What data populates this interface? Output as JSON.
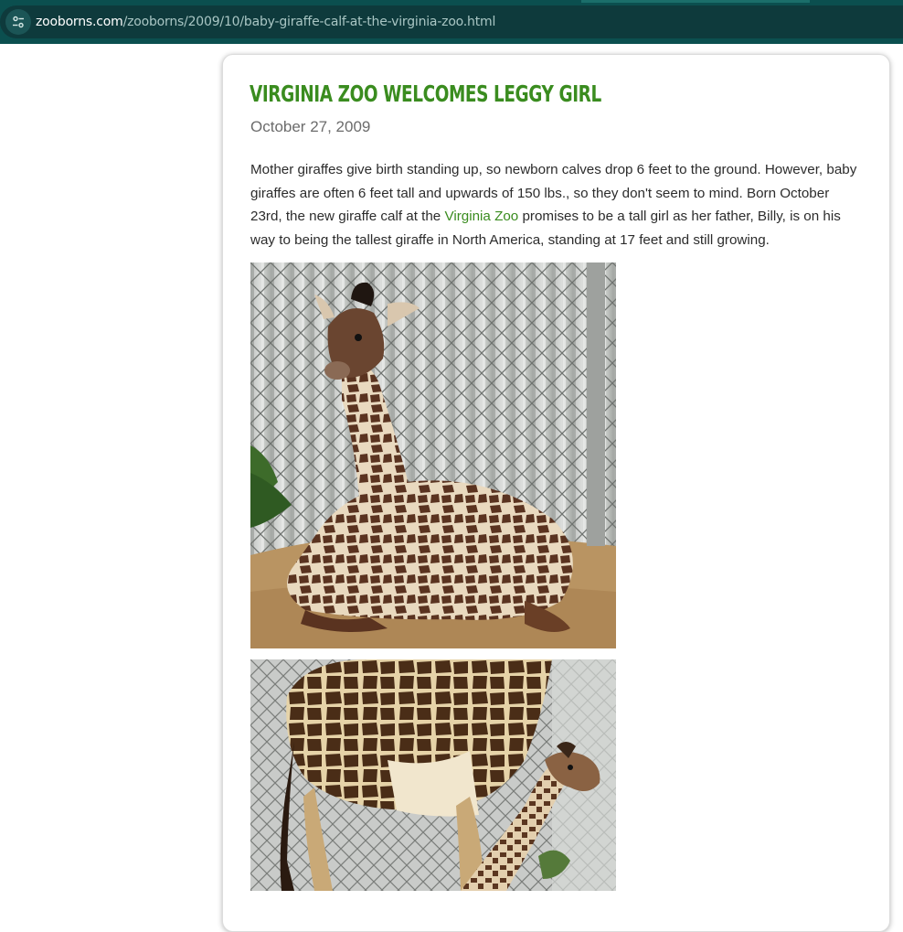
{
  "browser": {
    "url_domain": "zooborns.com",
    "url_path": "/zooborns/2009/10/baby-giraffe-calf-at-the-virginia-zoo.html",
    "site_info_icon": "tune-icon"
  },
  "post": {
    "title": "Virginia Zoo Welcomes Leggy Girl",
    "date": "October 27, 2009",
    "body_before_link": "Mother giraffes give birth standing up, so newborn calves drop 6 feet to the ground. However, baby giraffes are often 6 feet tall and upwards of 150 lbs., so they don't seem to mind. Born October 23rd, the new giraffe calf at the ",
    "link_text": "Virginia Zoo",
    "body_after_link": " promises to be a tall girl as her father, Billy, is on his way to being the tallest giraffe in North America, standing at 17 feet and still growing."
  },
  "colors": {
    "title_green": "#3a8c1f",
    "link_green": "#3a8c1f",
    "toolbar_teal": "#0b4f4f"
  }
}
